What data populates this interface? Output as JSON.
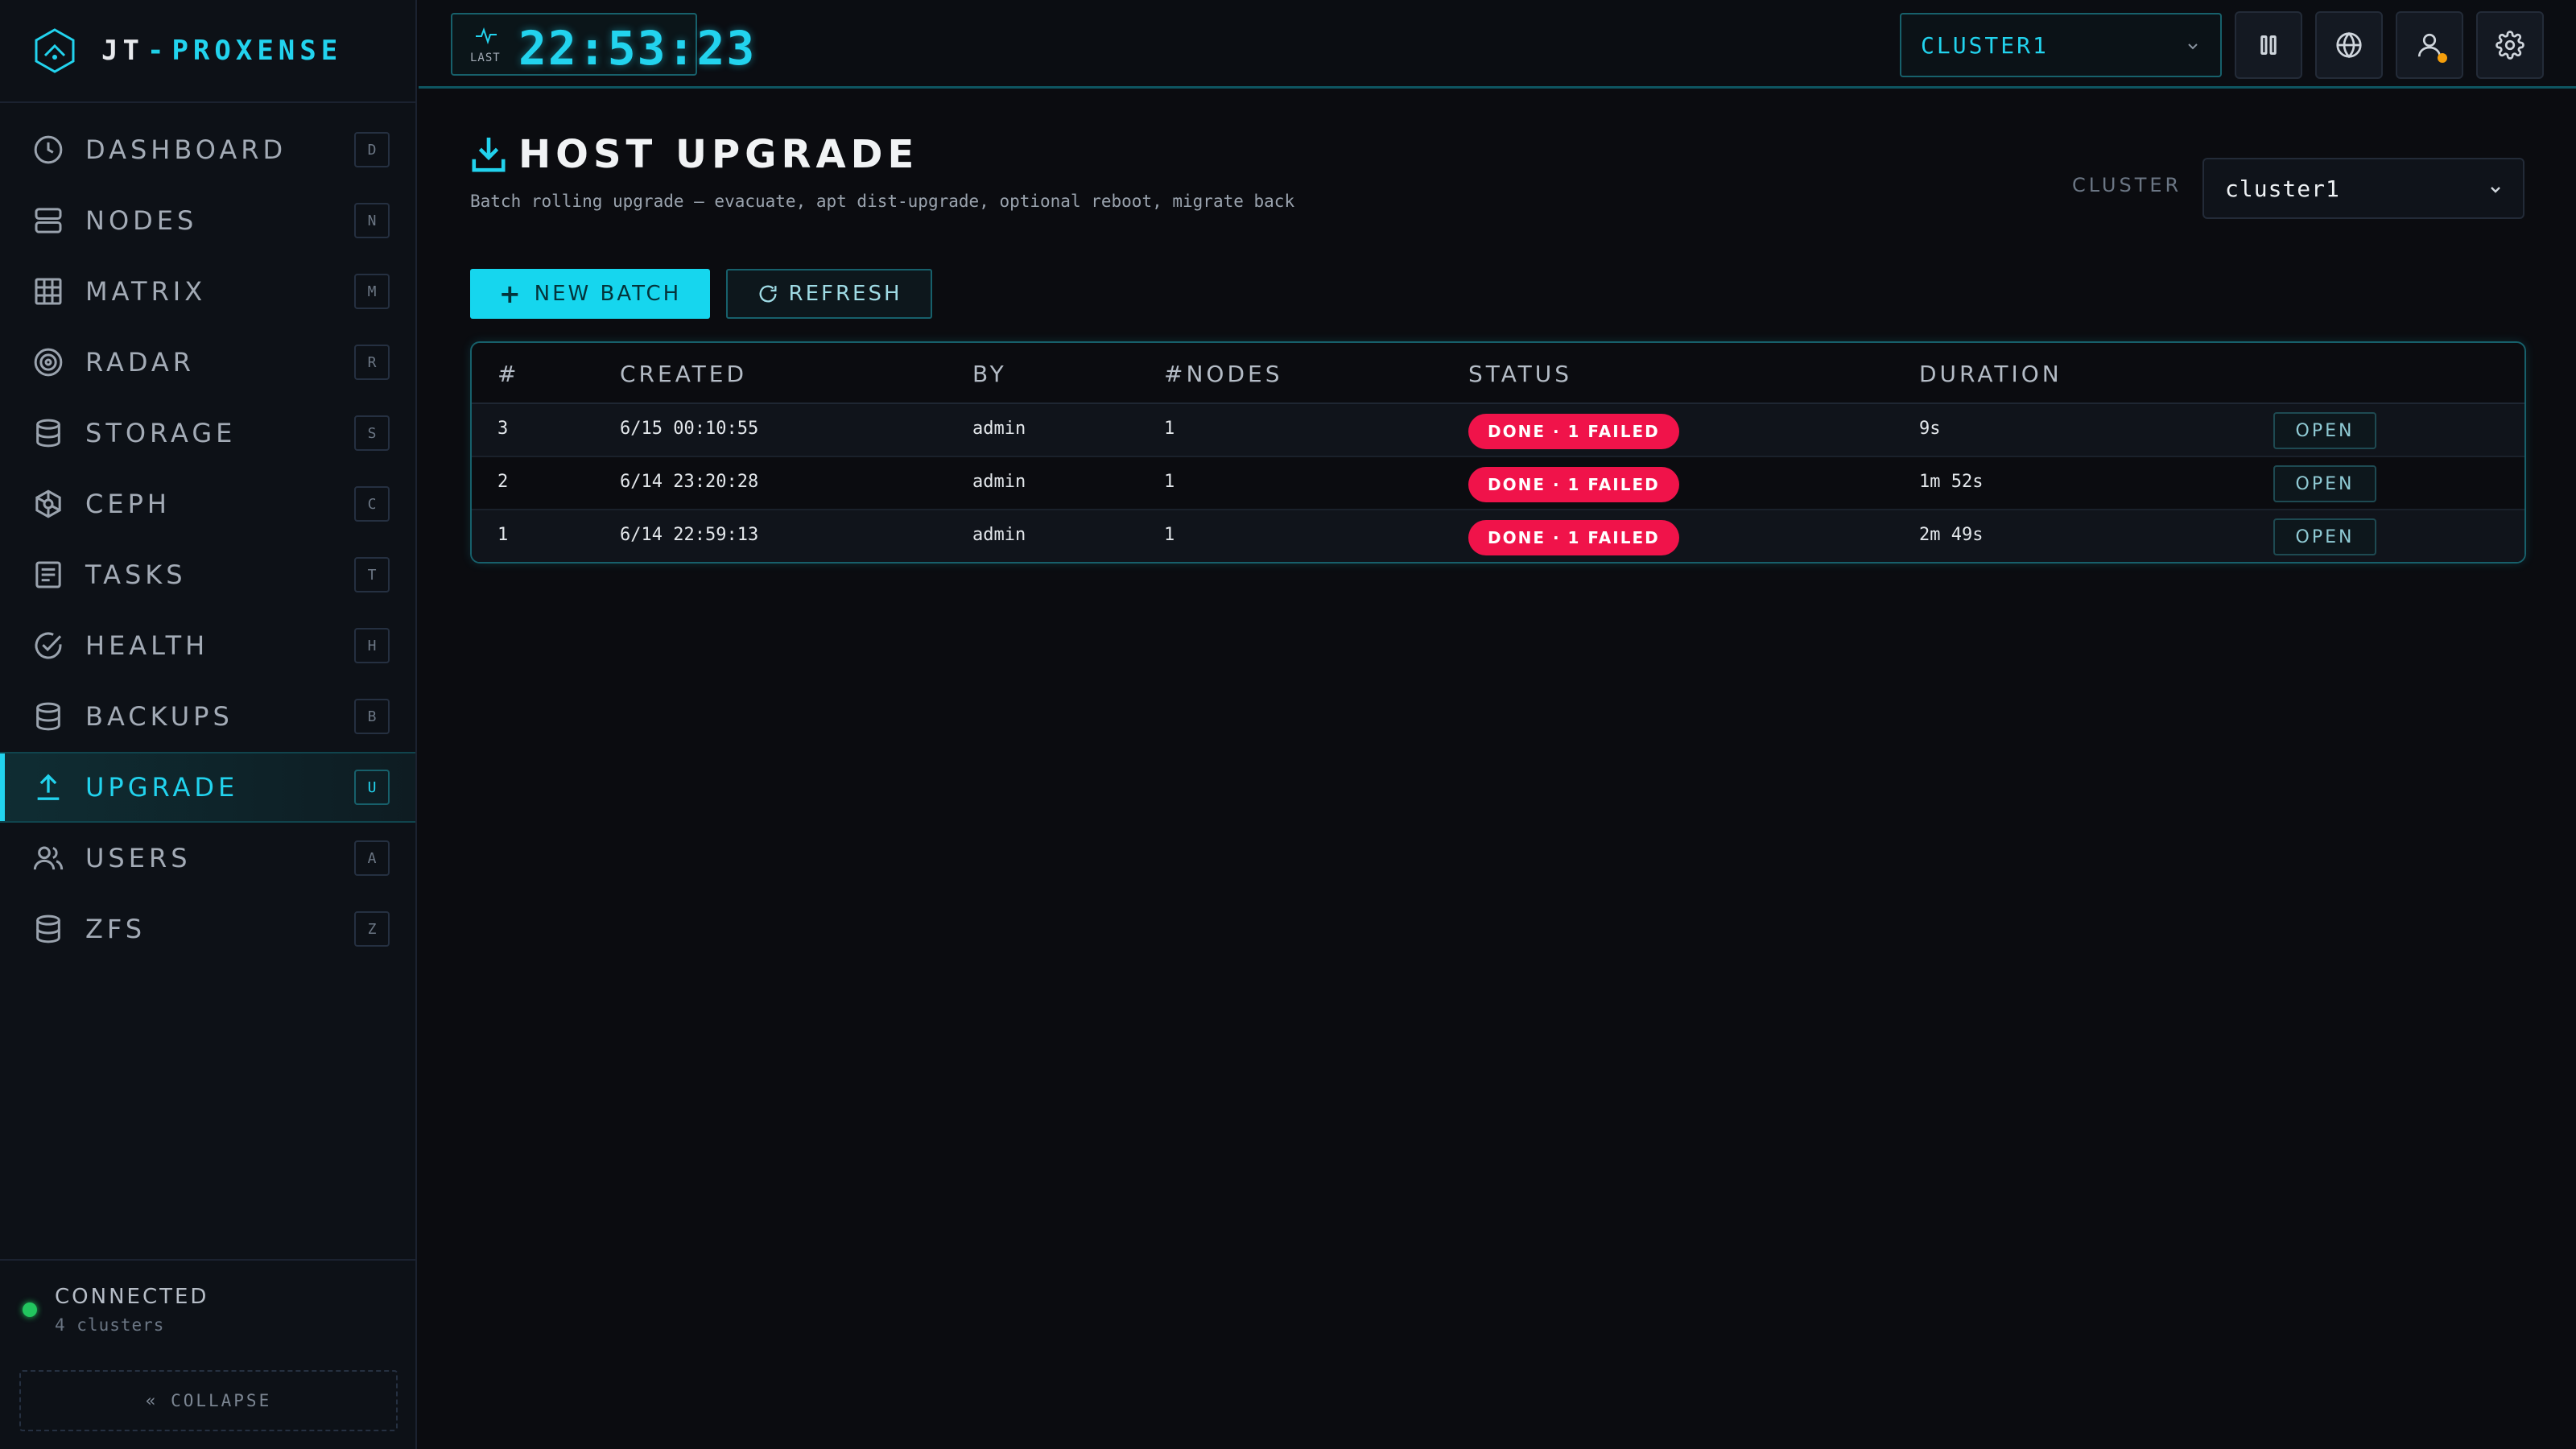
{
  "brand": {
    "name_left": "JT",
    "name_sep": "-",
    "name_right": "PROXENSE"
  },
  "sidebar": {
    "items": [
      {
        "label": "DASHBOARD",
        "key": "D",
        "icon": "clock-icon"
      },
      {
        "label": "NODES",
        "key": "N",
        "icon": "server-icon"
      },
      {
        "label": "MATRIX",
        "key": "M",
        "icon": "grid-icon"
      },
      {
        "label": "RADAR",
        "key": "R",
        "icon": "radar-icon"
      },
      {
        "label": "STORAGE",
        "key": "S",
        "icon": "database-icon"
      },
      {
        "label": "CEPH",
        "key": "C",
        "icon": "ceph-icon"
      },
      {
        "label": "TASKS",
        "key": "T",
        "icon": "tasks-icon"
      },
      {
        "label": "HEALTH",
        "key": "H",
        "icon": "check-circle-icon"
      },
      {
        "label": "BACKUPS",
        "key": "B",
        "icon": "database-icon"
      },
      {
        "label": "UPGRADE",
        "key": "U",
        "icon": "upload-icon",
        "active": true
      },
      {
        "label": "USERS",
        "key": "A",
        "icon": "users-icon"
      },
      {
        "label": "ZFS",
        "key": "Z",
        "icon": "database-icon"
      }
    ],
    "footer": {
      "status": "CONNECTED",
      "clusters": "4 clusters",
      "collapse": "« COLLAPSE"
    }
  },
  "topbar": {
    "clock_label": "LAST",
    "clock_time": "22:53:23",
    "cluster_select": "CLUSTER1"
  },
  "page": {
    "title": "HOST UPGRADE",
    "subtitle": "Batch rolling upgrade — evacuate, apt dist-upgrade, optional reboot, migrate back",
    "cluster_label": "CLUSTER",
    "cluster_value": "cluster1",
    "new_batch": "NEW BATCH",
    "refresh": "REFRESH"
  },
  "table": {
    "headers": [
      "#",
      "CREATED",
      "BY",
      "#NODES",
      "STATUS",
      "DURATION"
    ],
    "rows": [
      {
        "id": "3",
        "created": "6/15 00:10:55",
        "by": "admin",
        "nodes": "1",
        "status": "DONE · 1 FAILED",
        "duration": "9s",
        "action": "OPEN"
      },
      {
        "id": "2",
        "created": "6/14 23:20:28",
        "by": "admin",
        "nodes": "1",
        "status": "DONE · 1 FAILED",
        "duration": "1m 52s",
        "action": "OPEN"
      },
      {
        "id": "1",
        "created": "6/14 22:59:13",
        "by": "admin",
        "nodes": "1",
        "status": "DONE · 1 FAILED",
        "duration": "2m 49s",
        "action": "OPEN"
      }
    ]
  },
  "colors": {
    "accent": "#22d3ee",
    "danger": "#f0134a",
    "ok": "#22c55e",
    "background": "#0b0c10"
  }
}
